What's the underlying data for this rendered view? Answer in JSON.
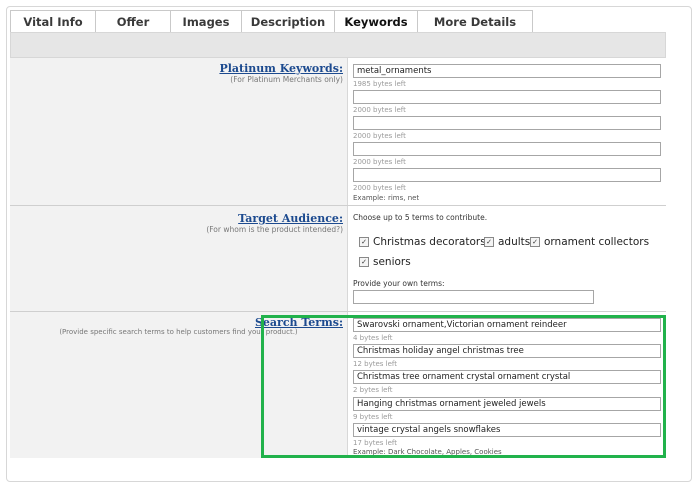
{
  "tabs": [
    "Vital Info",
    "Offer",
    "Images",
    "Description",
    "Keywords",
    "More Details"
  ],
  "active_tab": "Keywords",
  "platinum": {
    "label": "Platinum Keywords",
    "sublabel": "(For Platinum Merchants only)",
    "fields": [
      {
        "value": "metal_ornaments",
        "help": "1985 bytes left"
      },
      {
        "value": "",
        "help": "2000 bytes left"
      },
      {
        "value": "",
        "help": "2000 bytes left"
      },
      {
        "value": "",
        "help": "2000 bytes left"
      },
      {
        "value": "",
        "help": "2000 bytes left"
      }
    ],
    "example": "Example: rims, net"
  },
  "target": {
    "label": "Target Audience",
    "sublabel": "(For whom is the product intended?)",
    "choose": "Choose up to 5 terms to contribute.",
    "options": [
      "Christmas decorators",
      "adults",
      "ornament collectors",
      "seniors"
    ],
    "own_label": "Provide your own terms:",
    "own_value": ""
  },
  "search": {
    "label": "Search Terms",
    "sublabel": "(Provide specific search terms to help customers find your product.)",
    "fields": [
      {
        "value": "Swarovski ornament,Victorian ornament reindeer",
        "help": "4 bytes left"
      },
      {
        "value": "Christmas holiday angel christmas tree",
        "help": "12 bytes left"
      },
      {
        "value": "Christmas tree ornament crystal ornament crystal",
        "help": "2 bytes left"
      },
      {
        "value": "Hanging christmas ornament jeweled jewels",
        "help": "9 bytes left"
      },
      {
        "value": "vintage crystal angels snowflakes",
        "help": "17 bytes left"
      }
    ],
    "example": "Example: Dark Chocolate, Apples, Cookies"
  },
  "colors": {
    "link": "#1c4a8f",
    "highlight": "#21b24b"
  }
}
